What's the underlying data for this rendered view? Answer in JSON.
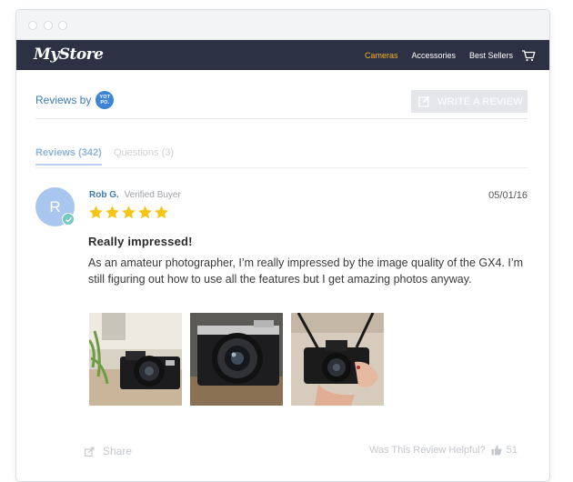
{
  "app": {
    "logo_text": "MyStore"
  },
  "nav": {
    "items": [
      {
        "label": "Cameras",
        "active": true
      },
      {
        "label": "Accessories",
        "active": false
      },
      {
        "label": "Best Sellers",
        "active": false
      }
    ],
    "cart_icon": "cart-icon"
  },
  "widget": {
    "reviews_by_label": "Reviews by",
    "provider_badge": "YOTPO",
    "write_review_label": "WRITE A REVIEW"
  },
  "tabs": {
    "reviews_label": "Reviews (342)",
    "questions_label": "Questions (3)"
  },
  "review": {
    "avatar_initial": "R",
    "author": "Rob G.",
    "status": "Verified Buyer",
    "date": "05/01/16",
    "rating": 5,
    "rating_max": 5,
    "title": "Really impressed!",
    "body": "As an amateur photographer, I’m really impressed by the image quality of the GX4. I’m still figuring out how to use all the features but I get amazing photos anyway.",
    "photos": [
      "camera-photo-1",
      "camera-photo-2",
      "camera-photo-3"
    ],
    "share_label": "Share",
    "helpful_label": "Was This Review Helpful?",
    "helpful_count": "51"
  },
  "colors": {
    "navbar": "#2c3143",
    "nav_active": "#f5b325",
    "link_blue": "#3d7cb8",
    "star_gold": "#f5c518",
    "avatar": "#a9c6ee",
    "verified_teal": "#76c9c0"
  }
}
